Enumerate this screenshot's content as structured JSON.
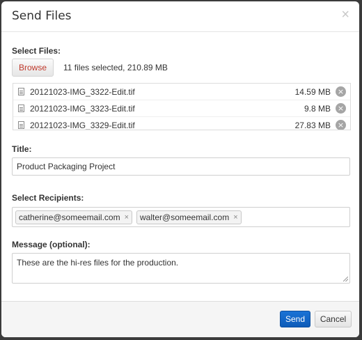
{
  "dialog": {
    "title": "Send Files",
    "close_glyph": "×"
  },
  "select_files": {
    "label": "Select Files:",
    "browse_label": "Browse",
    "summary": "11 files selected, 210.89 MB",
    "files": [
      {
        "name": "20121023-IMG_3322-Edit.tif",
        "size": "14.59 MB"
      },
      {
        "name": "20121023-IMG_3323-Edit.tif",
        "size": "9.8 MB"
      },
      {
        "name": "20121023-IMG_3329-Edit.tif",
        "size": "27.83 MB"
      }
    ],
    "remove_glyph": "×"
  },
  "title_field": {
    "label": "Title:",
    "value": "Product Packaging Project"
  },
  "recipients": {
    "label": "Select Recipients:",
    "tags": [
      {
        "email": "catherine@someemail.com"
      },
      {
        "email": "walter@someemail.com"
      }
    ],
    "remove_glyph": "×"
  },
  "message": {
    "label": "Message (optional):",
    "value": "These are the hi-res files for the production."
  },
  "footer": {
    "send_label": "Send",
    "cancel_label": "Cancel"
  },
  "colors": {
    "primary": "#0d5bb8",
    "browse_text": "#c0392b",
    "overlay": "#3b3b3b"
  }
}
